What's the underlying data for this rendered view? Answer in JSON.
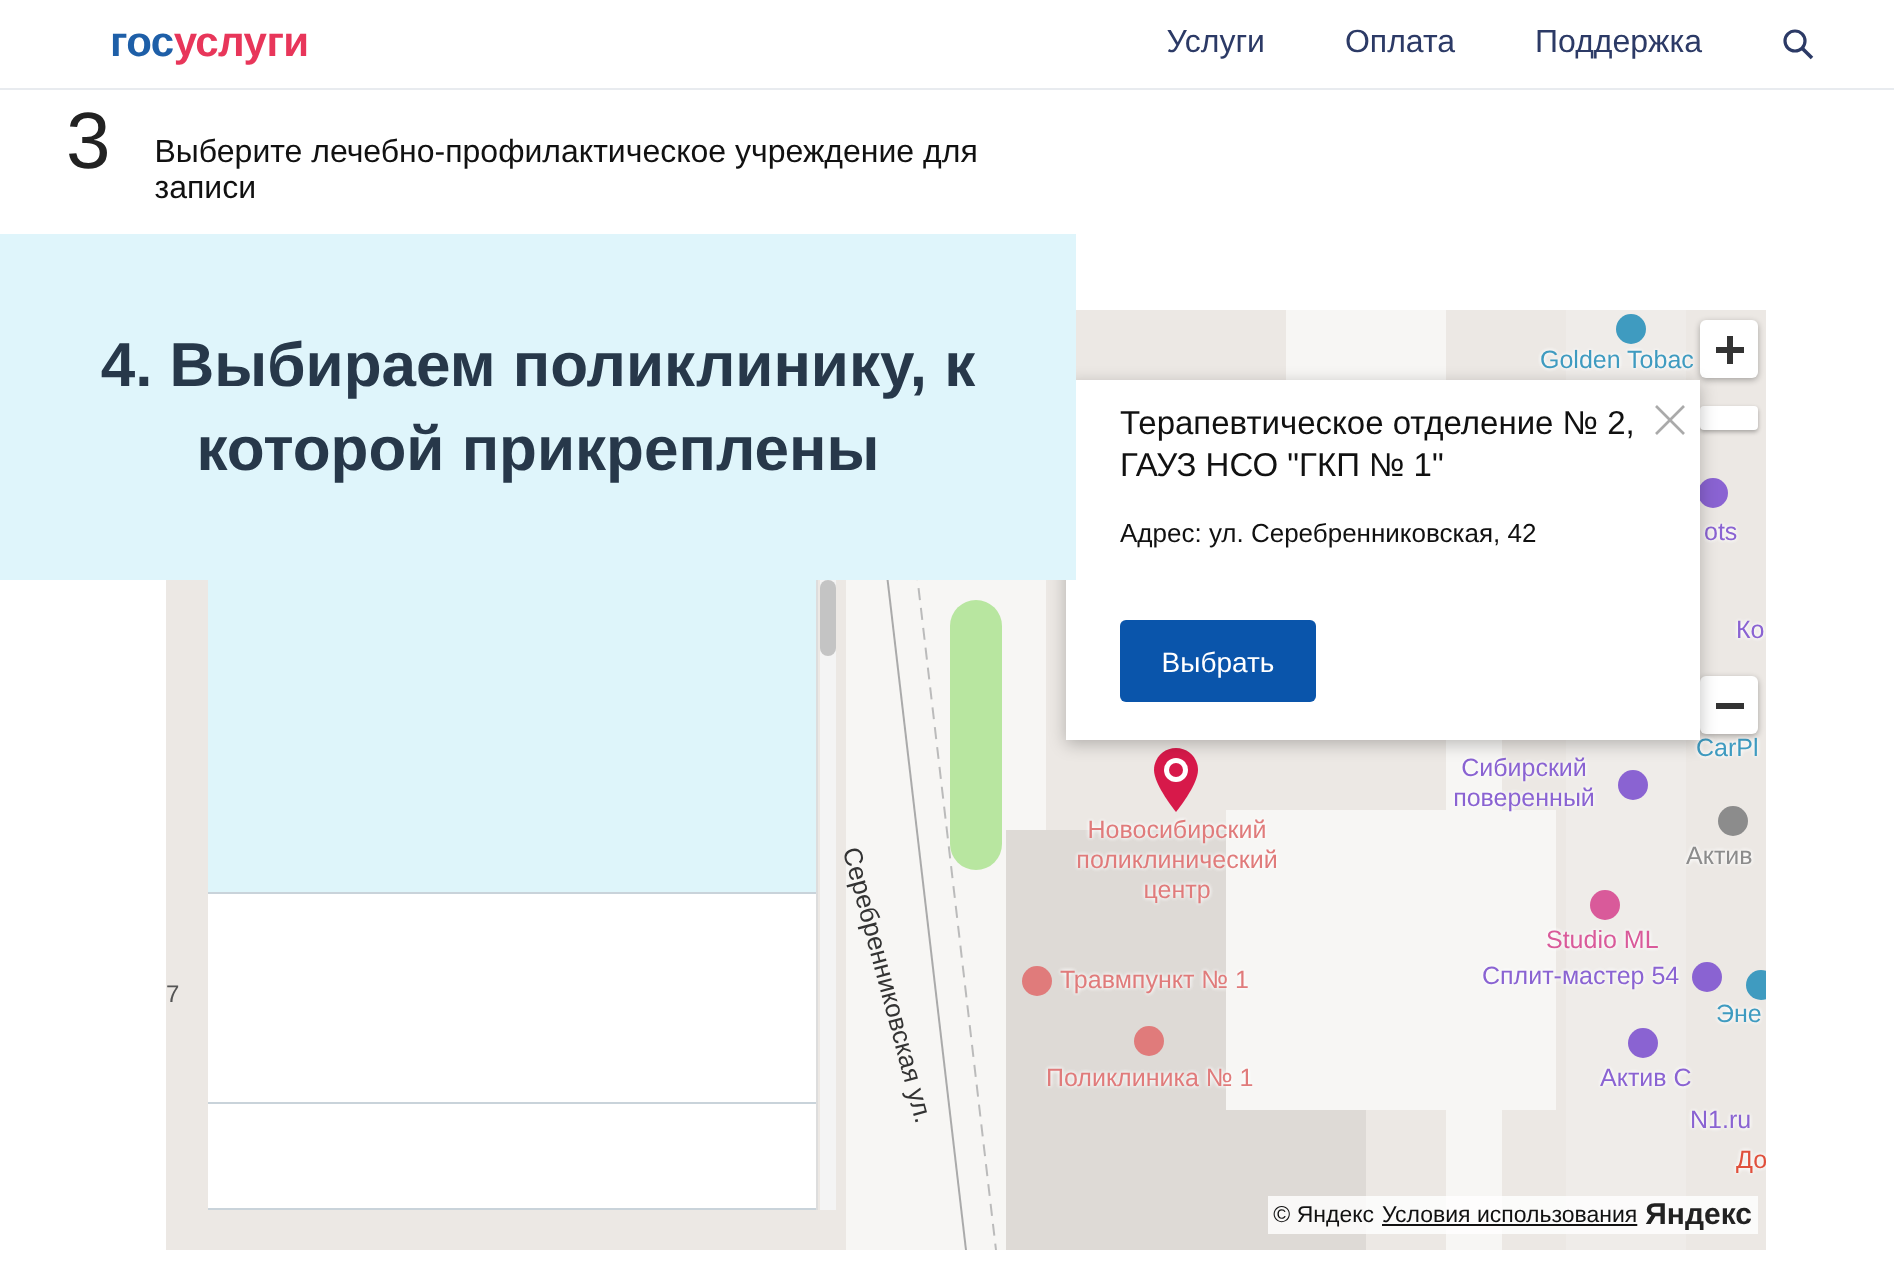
{
  "header": {
    "logo": {
      "prefix": "гос",
      "suffix": "услуги"
    },
    "nav": [
      {
        "label": "Услуги"
      },
      {
        "label": "Оплата"
      },
      {
        "label": "Поддержка"
      }
    ]
  },
  "step": {
    "number": "3",
    "title": "Выберите лечебно-профилактическое учреждение для записи"
  },
  "banner": {
    "text": "4. Выбираем поликлинику, к которой прикреплены"
  },
  "clinic_list": {
    "rows": [
      {
        "selected": true
      },
      {
        "selected": false
      },
      {
        "selected": false
      }
    ]
  },
  "map": {
    "labels": [
      {
        "text": "Golden Tobac",
        "color": "#3f9bc0"
      },
      {
        "text": "ots",
        "color": "#8a63d2"
      },
      {
        "text": "Ко",
        "color": "#8a63d2"
      },
      {
        "text": "CarPl",
        "color": "#3f9bc0"
      },
      {
        "text": "Сибирский поверенный",
        "color": "#8a63d2"
      },
      {
        "text": "Актив",
        "color": "#8c8c8c"
      },
      {
        "text": "Studio ML",
        "color": "#d95a9a"
      },
      {
        "text": "Сплит-мастер 54",
        "color": "#8a63d2"
      },
      {
        "text": "Эне",
        "color": "#3f9bc0"
      },
      {
        "text": "Актив С",
        "color": "#8a63d2"
      },
      {
        "text": "N1.ru",
        "color": "#8a63d2"
      },
      {
        "text": "До",
        "color": "#e0503c"
      },
      {
        "text": "Новосибирский поликлинический центр",
        "color": "#e07b7b"
      },
      {
        "text": "Травмпункт № 1",
        "color": "#e07b7b"
      },
      {
        "text": "Поликлиника № 1",
        "color": "#e07b7b"
      }
    ],
    "street": "Серебренниковская ул.",
    "edge_number": "7",
    "popup": {
      "title": "Терапевтическое отделение № 2, ГАУЗ НСО \"ГКП № 1\"",
      "address": "Адрес: ул. Серебренниковская, 42",
      "button": "Выбрать"
    },
    "attribution": {
      "copyright": "© Яндекс",
      "terms_link": "Условия использования",
      "logo": "Яндекс"
    }
  }
}
